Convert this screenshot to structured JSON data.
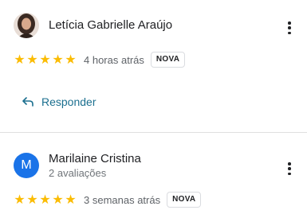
{
  "reviews": [
    {
      "author": "Letícia Gabrielle Araújo",
      "avatar_icon": "user-photo",
      "stars": 5,
      "time": "4 horas atrás",
      "badge": "NOVA",
      "reply_label": "Responder"
    },
    {
      "author": "Marilaine Cristina",
      "avatar_letter": "M",
      "avatar_color": "#1a73e8",
      "reviews_count": "2 avaliações",
      "stars": 5,
      "time": "3 semanas atrás",
      "badge": "NOVA"
    }
  ],
  "colors": {
    "star": "#fbbc04",
    "link": "#1b6f8f",
    "divider": "#e0e0e0"
  }
}
